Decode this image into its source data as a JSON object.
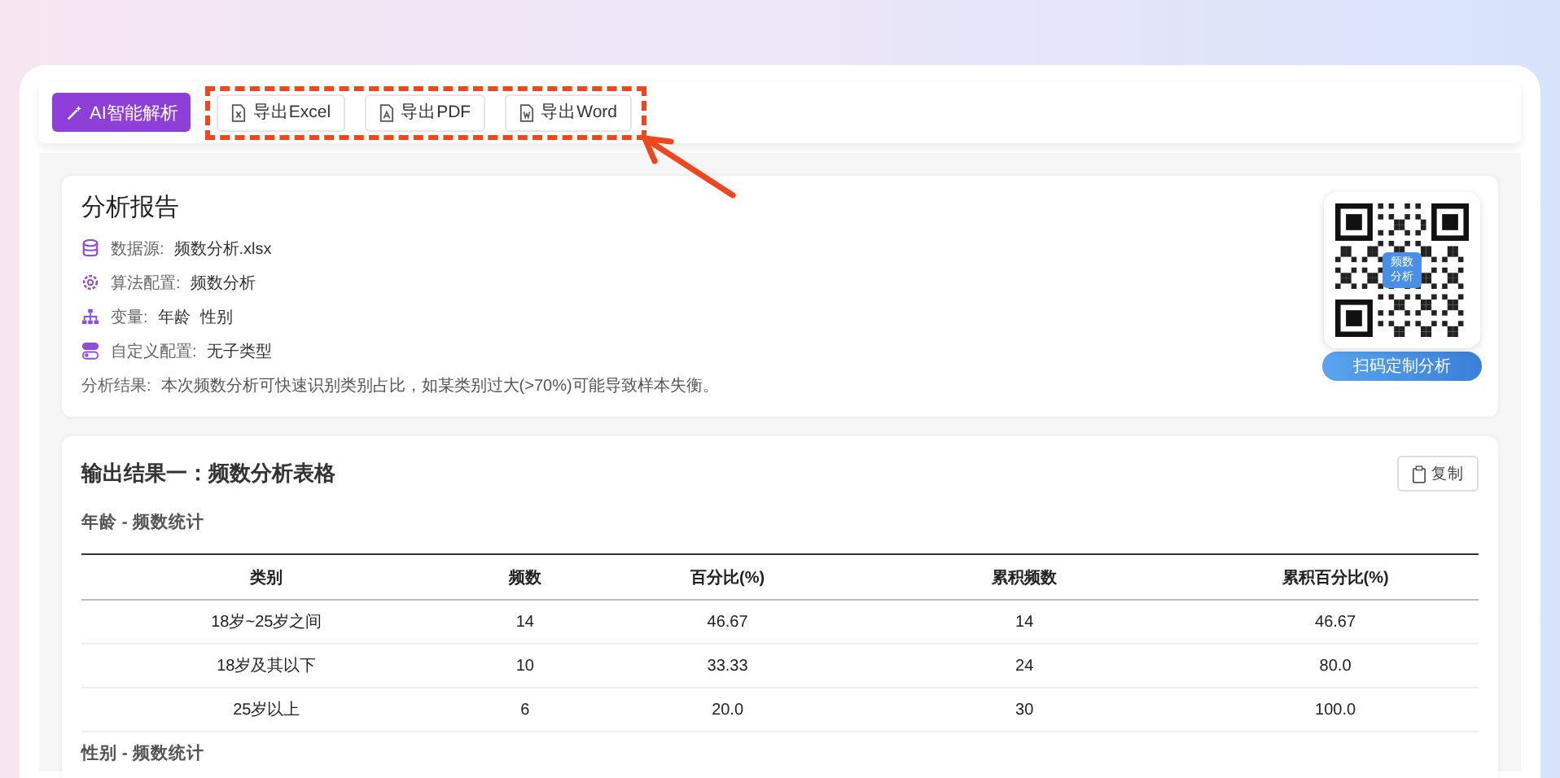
{
  "toolbar": {
    "ai_button": "AI智能解析",
    "export_buttons": [
      {
        "kind": "excel",
        "label": "导出Excel"
      },
      {
        "kind": "pdf",
        "label": "导出PDF"
      },
      {
        "kind": "word",
        "label": "导出Word"
      }
    ]
  },
  "report": {
    "title": "分析报告",
    "items": [
      {
        "kind": "database",
        "label": "数据源:",
        "values": [
          "频数分析.xlsx"
        ]
      },
      {
        "kind": "gear",
        "label": "算法配置:",
        "values": [
          "频数分析"
        ]
      },
      {
        "kind": "tree",
        "label": "变量:",
        "values": [
          "年龄",
          "性别"
        ]
      },
      {
        "kind": "toggle",
        "label": "自定义配置:",
        "values": [
          "无子类型"
        ]
      }
    ],
    "result_label": "分析结果:",
    "result_text": "本次频数分析可快速识别类别占比，如某类别过大(>70%)可能导致样本失衡。",
    "qr": {
      "badge": "频数分析",
      "button": "扫码定制分析"
    }
  },
  "output": {
    "title": "输出结果一：频数分析表格",
    "copy_button": "复制",
    "tables": [
      {
        "title": "年龄 - 频数统计",
        "columns": [
          "类别",
          "频数",
          "百分比(%)",
          "累积频数",
          "累积百分比(%)"
        ],
        "rows": [
          [
            "18岁~25岁之间",
            "14",
            "46.67",
            "14",
            "46.67"
          ],
          [
            "18岁及其以下",
            "10",
            "33.33",
            "24",
            "80.0"
          ],
          [
            "25岁以上",
            "6",
            "20.0",
            "30",
            "100.0"
          ]
        ]
      }
    ],
    "next_title": "性别 - 频数统计"
  }
}
